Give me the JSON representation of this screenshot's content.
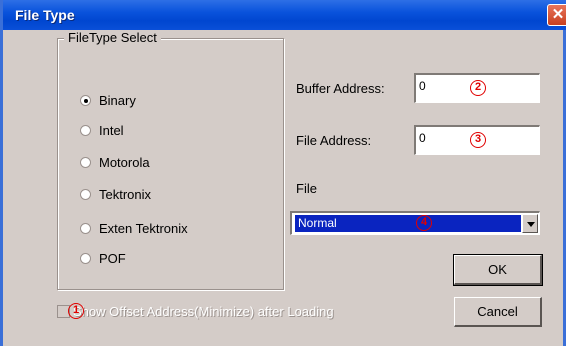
{
  "window": {
    "title": "File Type",
    "close_glyph": "✕"
  },
  "filetype_group": {
    "legend": "FileType Select",
    "options": [
      {
        "label": "Binary",
        "checked": true
      },
      {
        "label": "Intel",
        "checked": false
      },
      {
        "label": "Motorola",
        "checked": false
      },
      {
        "label": "Tektronix",
        "checked": false
      },
      {
        "label": "Exten Tektronix",
        "checked": false
      },
      {
        "label": "POF",
        "checked": false
      }
    ]
  },
  "buffer_address": {
    "label": "Buffer Address:",
    "value": "0",
    "marker": "2"
  },
  "file_address": {
    "label": "File Address:",
    "value": "0",
    "marker": "3"
  },
  "file": {
    "label": "File",
    "selected": "Normal",
    "marker": "4"
  },
  "buttons": {
    "ok": "OK",
    "cancel": "Cancel"
  },
  "show_offset": {
    "label": "Show Offset Address(Minimize) after Loading",
    "checked": false,
    "disabled": true,
    "marker": "1"
  },
  "colors": {
    "titlebar": "#0a53dc",
    "dialog_bg": "#d4ccc8",
    "marker_red": "#e00000",
    "selection": "#0a24c0"
  }
}
